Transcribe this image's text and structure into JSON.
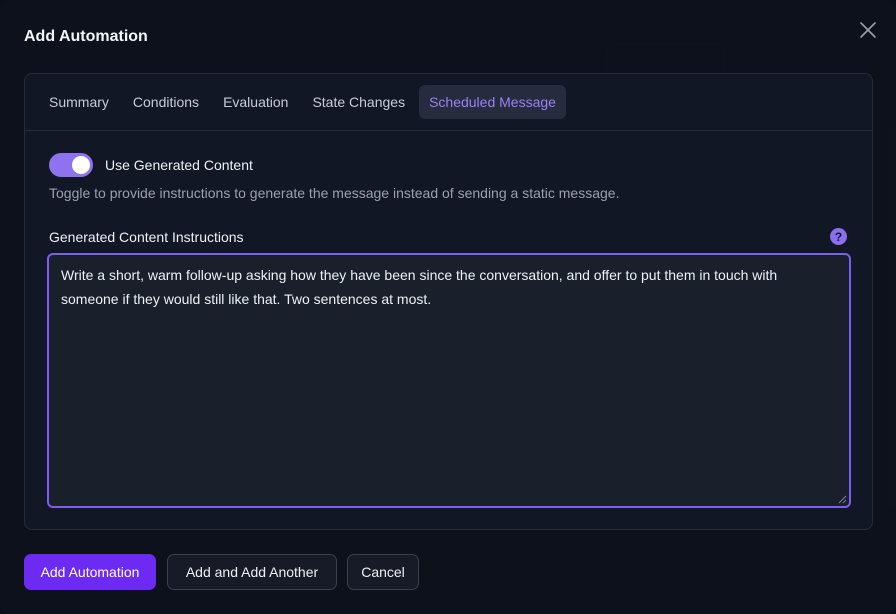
{
  "modal": {
    "title": "Add Automation"
  },
  "tabs": [
    {
      "label": "Summary",
      "active": false
    },
    {
      "label": "Conditions",
      "active": false
    },
    {
      "label": "Evaluation",
      "active": false
    },
    {
      "label": "State Changes",
      "active": false
    },
    {
      "label": "Scheduled Message",
      "active": true
    }
  ],
  "toggle": {
    "label": "Use Generated Content",
    "on": true,
    "help": "Toggle to provide instructions to generate the message instead of sending a static message."
  },
  "instructions": {
    "label": "Generated Content Instructions",
    "help_glyph": "?",
    "value": "Write a short, warm follow-up asking how they have been since the conversation, and offer to put them in touch with someone if they would still like that. Two sentences at most."
  },
  "footer": {
    "primary_label": "Add Automation",
    "add_another_label": "Add and Add Another",
    "cancel_label": "Cancel"
  },
  "colors": {
    "accent": "#6d2af2",
    "tab_active_text": "#9c7ef7",
    "toggle_on": "#8f73ee",
    "focus_border": "#7d5cf0"
  },
  "icons": {
    "close": "close-icon",
    "help": "question-circle-icon"
  }
}
